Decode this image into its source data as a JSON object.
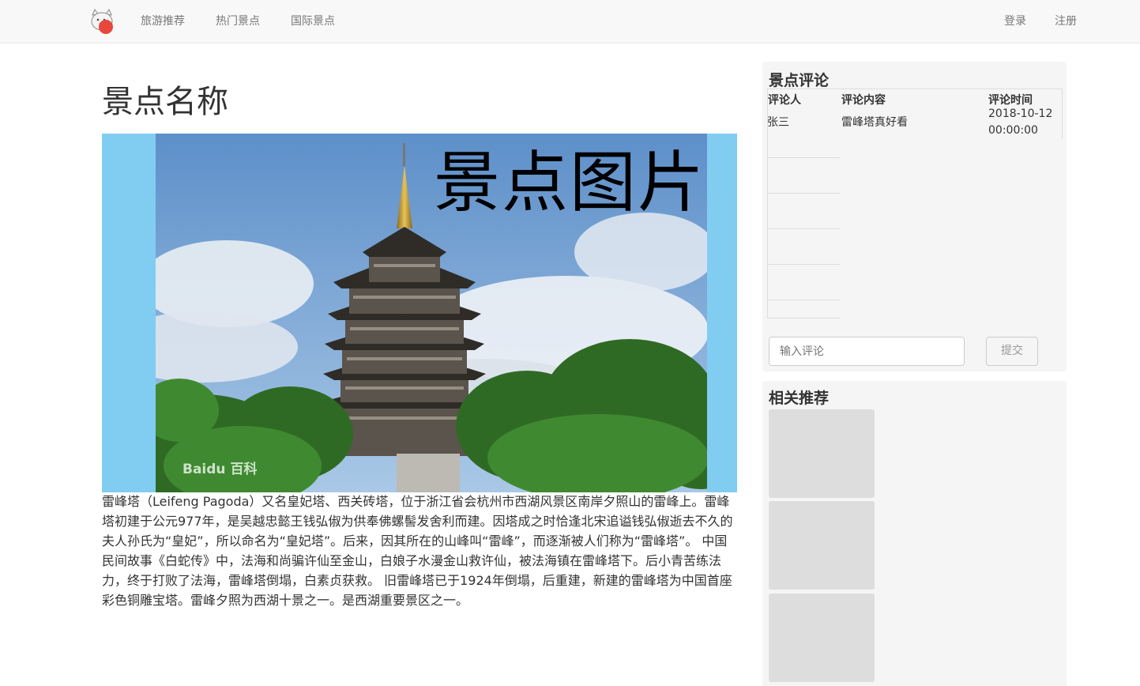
{
  "navbar": {
    "logo_icon": "lucky-cat-logo",
    "links": [
      "旅游推荐",
      "热门景点",
      "国际景点"
    ],
    "login": "登录",
    "register": "注册"
  },
  "main": {
    "title": "景点名称",
    "image_caption": "景点图片",
    "watermark": "Baidu 百科",
    "description": "雷峰塔（Leifeng Pagoda）又名皇妃塔、西关砖塔，位于浙江省会杭州市西湖风景区南岸夕照山的雷峰上。雷峰塔初建于公元977年，是吴越忠懿王钱弘俶为供奉佛螺髻发舍利而建。因塔成之时恰逢北宋追谥钱弘俶逝去不久的夫人孙氏为“皇妃”，所以命名为“皇妃塔”。后来，因其所在的山峰叫“雷峰”，而逐渐被人们称为“雷峰塔”。 中国民间故事《白蛇传》中，法海和尚骗许仙至金山，白娘子水漫金山救许仙，被法海镇在雷峰塔下。后小青苦练法力，终于打败了法海，雷峰塔倒塌，白素贞获救。 旧雷峰塔已于1924年倒塌，后重建，新建的雷峰塔为中国首座彩色铜雕宝塔。雷峰夕照为西湖十景之一。是西湖重要景区之一。"
  },
  "comments": {
    "title": "景点评论",
    "headers": [
      "评论人",
      "评论内容",
      "评论时间"
    ],
    "rows": [
      {
        "user": "张三",
        "content": "雷峰塔真好看",
        "time": "2018-10-12 00:00:00"
      }
    ],
    "input_placeholder": "输入评论",
    "submit_label": "提交"
  },
  "recommend": {
    "title": "相关推荐"
  },
  "colors": {
    "navbar_bg": "#f8f8f8",
    "image_frame_bg": "#81cdf2",
    "panel_bg": "#f5f5f5",
    "placeholder_card": "#dddddd"
  }
}
